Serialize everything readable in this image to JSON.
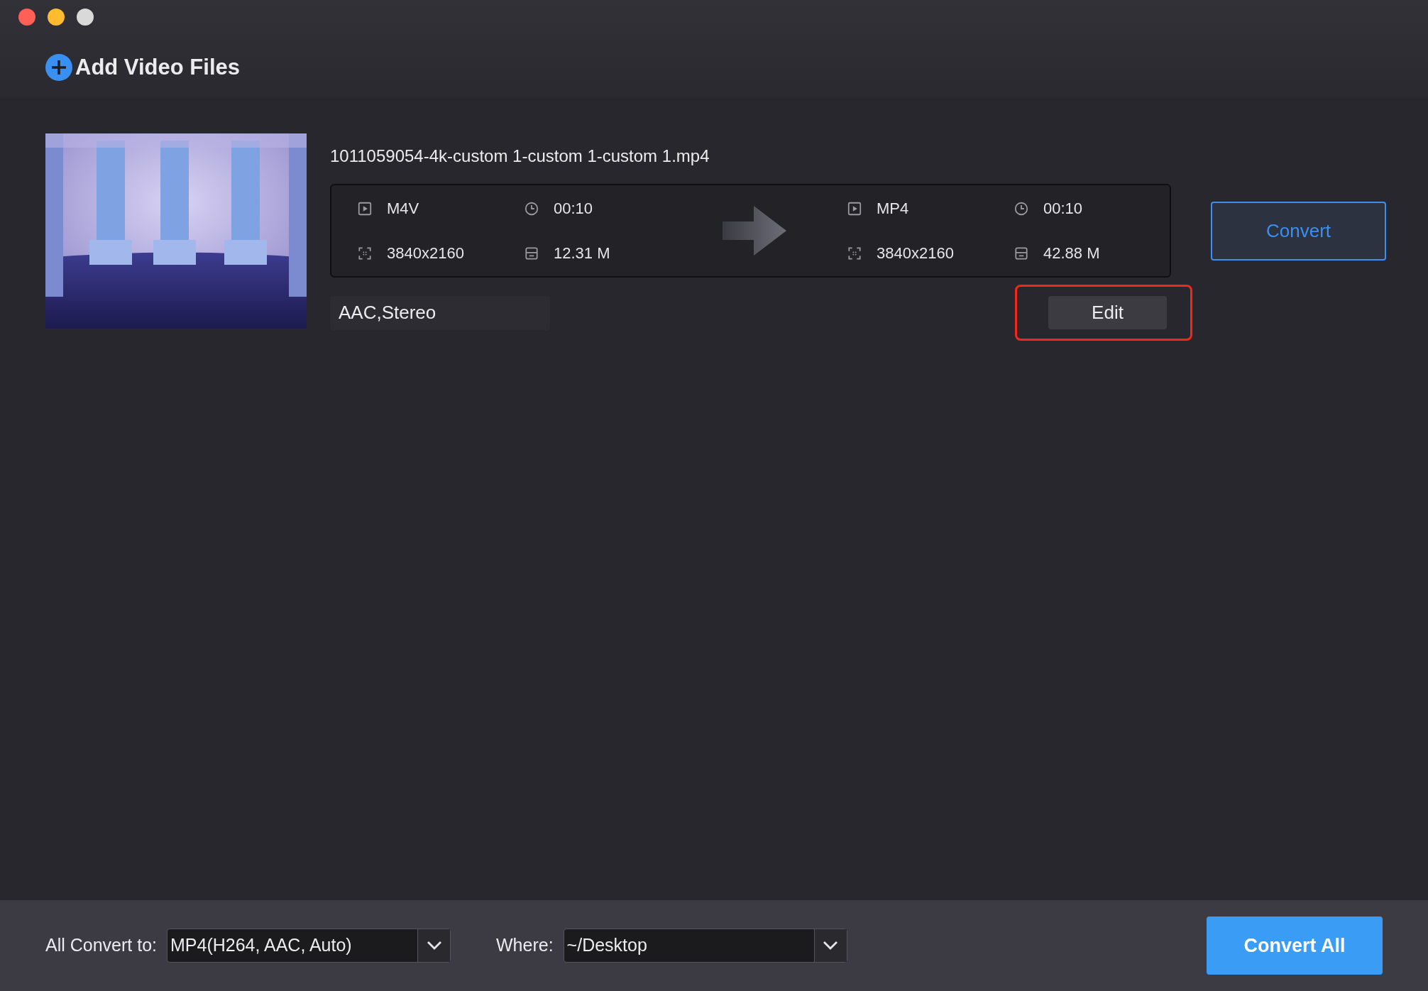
{
  "window": {
    "traffic_lights": [
      {
        "color": "#fe5f57"
      },
      {
        "color": "#febc2e"
      },
      {
        "color": "#d9d9d9"
      }
    ]
  },
  "toolbar": {
    "add_button": "Add Video Files"
  },
  "files": [
    {
      "name": "1011059054-4k-custom 1-custom 1-custom 1.mp4",
      "source": {
        "format": "M4V",
        "duration": "00:10",
        "resolution": "3840x2160",
        "size": "12.31 M"
      },
      "target": {
        "format": "MP4",
        "duration": "00:10",
        "resolution": "3840x2160",
        "size": "42.88 M"
      },
      "audio": "AAC,Stereo",
      "edit_button": {
        "label": "Edit",
        "highlighted": true
      },
      "convert_button": "Convert"
    }
  ],
  "bottom_bar": {
    "convert_to_label": "All Convert to:",
    "convert_to_value": "MP4(H264, AAC, Auto)",
    "where_label": "Where:",
    "where_value": "~/Desktop",
    "convert_all": "Convert All"
  }
}
